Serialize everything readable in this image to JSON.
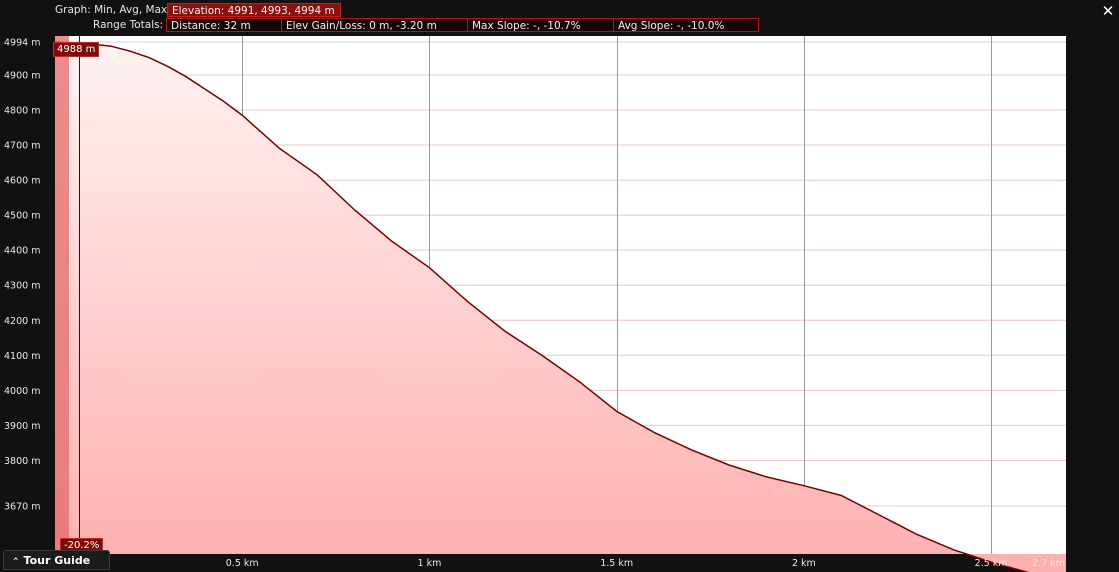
{
  "header": {
    "graph_label": "Graph: Min, Avg, Max",
    "elevation": "Elevation: 4991, 4993, 4994 m",
    "range_label": "Range Totals:",
    "distance": "Distance: 32 m",
    "elev_gain_loss": "Elev Gain/Loss: 0 m, -3.20 m",
    "max_slope": "Max Slope: -, -10.7%",
    "avg_slope": "Avg Slope: -, -10.0%"
  },
  "close_icon": "close-icon",
  "cursor": {
    "elevation_label": "4988 m",
    "slope_label": "-20.2%"
  },
  "tour_guide": {
    "label": "Tour Guide",
    "icon": "double-chevron-up-icon"
  },
  "colors": {
    "accent": "#b01414",
    "line": "#7a0000",
    "fill_top": "#fff0f0",
    "fill_bottom": "#ffb0b0",
    "background": "#111111"
  },
  "chart_data": {
    "type": "area",
    "title": "",
    "xlabel": "",
    "ylabel": "",
    "x_unit": "km",
    "y_unit": "m",
    "xlim": [
      0,
      2.7
    ],
    "ylim": [
      3620,
      4994
    ],
    "x_ticks": [
      {
        "value": 0.5,
        "label": "0.5 km"
      },
      {
        "value": 1.0,
        "label": "1 km"
      },
      {
        "value": 1.5,
        "label": "1.5 km"
      },
      {
        "value": 2.0,
        "label": "2 km"
      },
      {
        "value": 2.5,
        "label": "2.5 km"
      },
      {
        "value": 2.7,
        "label": "2.7 km"
      }
    ],
    "y_ticks": [
      {
        "value": 4994,
        "label": "4994 m"
      },
      {
        "value": 4900,
        "label": "4900 m"
      },
      {
        "value": 4800,
        "label": "4800 m"
      },
      {
        "value": 4700,
        "label": "4700 m"
      },
      {
        "value": 4600,
        "label": "4600 m"
      },
      {
        "value": 4500,
        "label": "4500 m"
      },
      {
        "value": 4400,
        "label": "4400 m"
      },
      {
        "value": 4300,
        "label": "4300 m"
      },
      {
        "value": 4200,
        "label": "4200 m"
      },
      {
        "value": 4100,
        "label": "4100 m"
      },
      {
        "value": 4000,
        "label": "4000 m"
      },
      {
        "value": 3900,
        "label": "3900 m"
      },
      {
        "value": 3800,
        "label": "3800 m"
      },
      {
        "value": 3670,
        "label": "3670 m"
      }
    ],
    "selected_range": [
      0,
      0.065
    ],
    "cursor_x": 0.065,
    "grid": true,
    "series": [
      {
        "x": [
          0,
          0.06,
          0.1,
          0.15,
          0.2,
          0.25,
          0.3,
          0.35,
          0.4,
          0.45,
          0.5,
          0.6,
          0.7,
          0.8,
          0.9,
          1.0,
          1.1,
          1.2,
          1.3,
          1.4,
          1.5,
          1.6,
          1.7,
          1.8,
          1.9,
          2.0,
          2.1,
          2.2,
          2.3,
          2.4,
          2.5,
          2.6,
          2.7
        ],
        "y": [
          4994,
          4991,
          4988,
          4982,
          4968,
          4950,
          4925,
          4895,
          4860,
          4825,
          4785,
          4690,
          4615,
          4515,
          4425,
          4350,
          4255,
          4170,
          4100,
          4025,
          3940,
          3880,
          3830,
          3787,
          3753,
          3728,
          3700,
          3645,
          3590,
          3545,
          3510,
          3480,
          3460
        ]
      }
    ]
  }
}
